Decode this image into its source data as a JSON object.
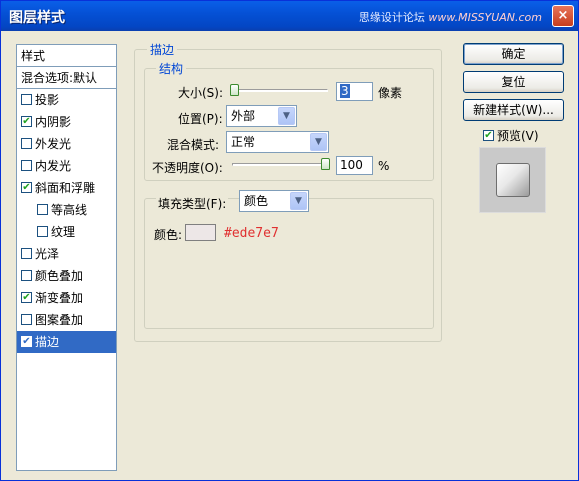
{
  "window": {
    "title": "图层样式",
    "watermark_text": "思缘设计论坛",
    "watermark_url": "www.MISSYUAN.com",
    "close_label": "×"
  },
  "style_list": {
    "header": "样式",
    "blend_options": "混合选项:默认",
    "items": [
      {
        "label": "投影",
        "checked": false,
        "indent": false,
        "selected": false
      },
      {
        "label": "内阴影",
        "checked": true,
        "indent": false,
        "selected": false
      },
      {
        "label": "外发光",
        "checked": false,
        "indent": false,
        "selected": false
      },
      {
        "label": "内发光",
        "checked": false,
        "indent": false,
        "selected": false
      },
      {
        "label": "斜面和浮雕",
        "checked": true,
        "indent": false,
        "selected": false
      },
      {
        "label": "等高线",
        "checked": false,
        "indent": true,
        "selected": false
      },
      {
        "label": "纹理",
        "checked": false,
        "indent": true,
        "selected": false
      },
      {
        "label": "光泽",
        "checked": false,
        "indent": false,
        "selected": false
      },
      {
        "label": "颜色叠加",
        "checked": false,
        "indent": false,
        "selected": false
      },
      {
        "label": "渐变叠加",
        "checked": true,
        "indent": false,
        "selected": false
      },
      {
        "label": "图案叠加",
        "checked": false,
        "indent": false,
        "selected": false
      },
      {
        "label": "描边",
        "checked": true,
        "indent": false,
        "selected": true
      }
    ]
  },
  "stroke_panel": {
    "group_title": "描边",
    "structure_title": "结构",
    "size_label": "大小(S):",
    "size_value": "3",
    "size_unit": "像素",
    "size_slider_level": 0.0,
    "position_label": "位置(P):",
    "position_value": "外部",
    "blend_label": "混合模式:",
    "blend_value": "正常",
    "opacity_label": "不透明度(O):",
    "opacity_value": "100",
    "opacity_unit": "%",
    "opacity_slider_level": 1.0,
    "fill_type_label": "填充类型(F):",
    "fill_type_value": "颜色",
    "color_label": "颜色:",
    "color_swatch": "#ede7e7",
    "color_hex_text": "#ede7e7"
  },
  "buttons": {
    "ok": "确定",
    "reset": "复位",
    "new_style": "新建样式(W)...",
    "preview_label": "预览(V)",
    "preview_checked": true
  },
  "colors": {
    "title_bar": "#0551d6",
    "selection": "#316ac5",
    "group_title": "#0046d5"
  }
}
